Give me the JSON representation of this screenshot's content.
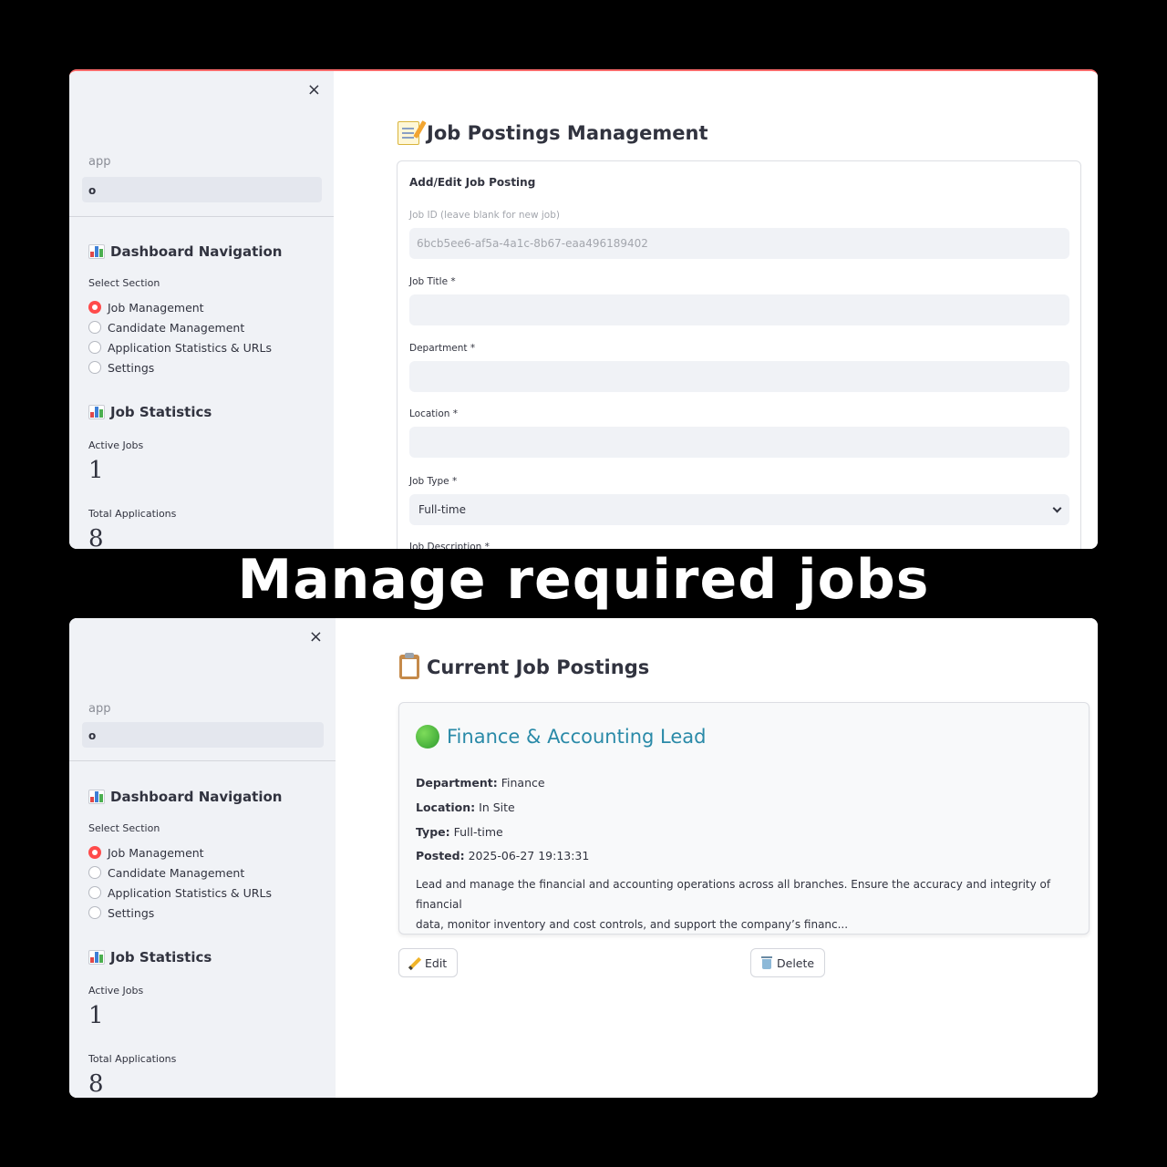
{
  "banner": {
    "text": "Manage required jobs"
  },
  "sidebar": {
    "close_symbol": "×",
    "app_label": "app",
    "app_value": "o",
    "nav_heading": "Dashboard Navigation",
    "select_label": "Select Section",
    "options": [
      "Job Management",
      "Candidate Management",
      "Application Statistics & URLs",
      "Settings"
    ],
    "selected": "Job Management",
    "stats_heading": "Job Statistics",
    "active_jobs_label": "Active Jobs",
    "active_jobs_value": "1",
    "total_apps_label": "Total Applications",
    "total_apps_value": "8",
    "icons": {
      "close": "close-icon",
      "chart": "bar-chart-icon"
    }
  },
  "top": {
    "title": "Job Postings Management",
    "form": {
      "heading": "Add/Edit Job Posting",
      "job_id_label": "Job ID (leave blank for new job)",
      "job_id_value": "6bcb5ee6-af5a-4a1c-8b67-eaa496189402",
      "job_title_label": "Job Title *",
      "job_title_value": "",
      "department_label": "Department *",
      "department_value": "",
      "location_label": "Location *",
      "location_value": "",
      "job_type_label": "Job Type *",
      "job_type_value": "Full-time",
      "description_label": "Job Description *"
    }
  },
  "bottom": {
    "title": "Current Job Postings",
    "job": {
      "title": "Finance & Accounting Lead",
      "department_key": "Department:",
      "department": "Finance",
      "location_key": "Location:",
      "location": "In Site",
      "type_key": "Type:",
      "type": "Full-time",
      "posted_key": "Posted:",
      "posted": "2025-06-27 19:13:31",
      "description_line1": "Lead and manage the financial and accounting operations across all branches. Ensure the accuracy and integrity of financial",
      "description_line2": "data, monitor inventory and cost controls, and support the company’s financ..."
    },
    "edit_label": "Edit",
    "delete_label": "Delete"
  },
  "colors": {
    "accent": "#ff4b4b",
    "job_title": "#2a8aa8",
    "sidebar_bg": "#f0f2f6",
    "status": "#3cb043"
  }
}
